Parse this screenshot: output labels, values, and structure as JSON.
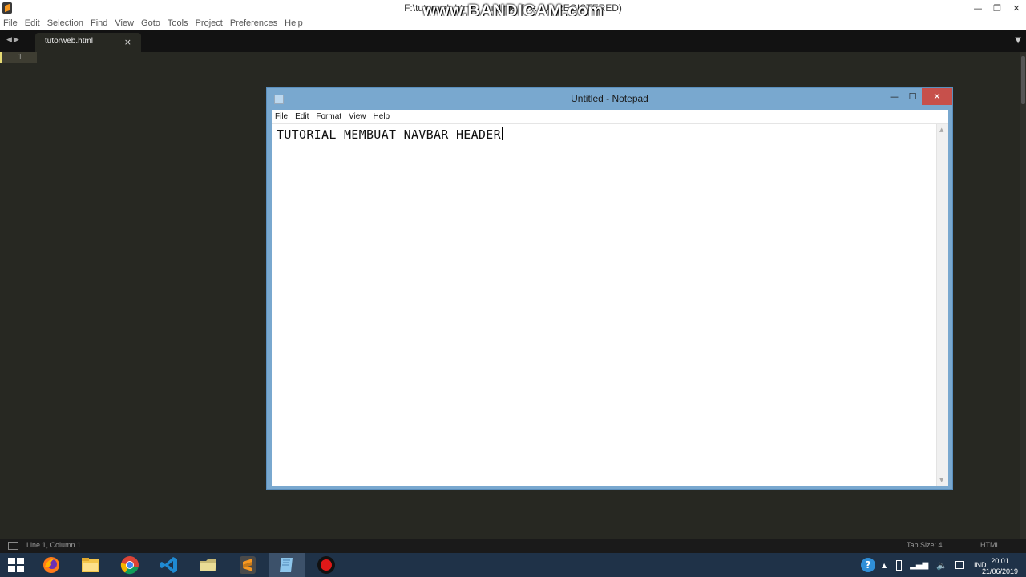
{
  "sublime": {
    "window_title": "F:\\tutorweb.html - Sublime Text (UNREGISTERED)",
    "watermark": "www.BANDICAM.com",
    "menu": [
      "File",
      "Edit",
      "Selection",
      "Find",
      "View",
      "Goto",
      "Tools",
      "Project",
      "Preferences",
      "Help"
    ],
    "tab": {
      "label": "tutorweb.html",
      "close": "×"
    },
    "editor": {
      "line_number": "1"
    },
    "status": {
      "position": "Line 1, Column 1",
      "tab_size": "Tab Size: 4",
      "syntax": "HTML"
    }
  },
  "notepad": {
    "title": "Untitled - Notepad",
    "menu": [
      "File",
      "Edit",
      "Format",
      "View",
      "Help"
    ],
    "content": "TUTORIAL MEMBUAT NAVBAR HEADER"
  },
  "taskbar": {
    "apps": [
      "firefox",
      "chrome",
      "vscode",
      "file-explorer",
      "folder",
      "sublime-text",
      "notepad",
      "bandicam"
    ],
    "tray": {
      "language": "IND"
    },
    "clock": {
      "time": "20:01",
      "date": "21/06/2019"
    }
  },
  "colors": {
    "editor_bg": "#272822",
    "taskbar_bg": "#1f3248",
    "notepad_frame": "#79a8cf",
    "close_button": "#c7504b"
  }
}
